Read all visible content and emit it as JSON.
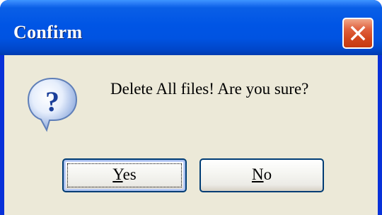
{
  "window": {
    "title": "Confirm"
  },
  "message": {
    "text": "Delete All files! Are you sure?",
    "icon": "question-icon"
  },
  "buttons": {
    "yes": {
      "accel": "Y",
      "rest": "es"
    },
    "no": {
      "accel": "N",
      "rest": "o"
    }
  },
  "icons": {
    "close": "close-icon",
    "question": "question-icon"
  },
  "colors": {
    "titlebar": "#0055e5",
    "close_button": "#d2461d",
    "client_background": "#ece9d8",
    "button_border": "#003c74"
  }
}
